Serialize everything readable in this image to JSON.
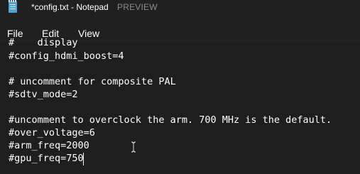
{
  "window": {
    "title": "*config.txt - Notepad",
    "badge": "PREVIEW"
  },
  "menu": {
    "file": "File",
    "edit": "Edit",
    "view": "View"
  },
  "editor": {
    "lines": [
      "#config_hdmi_boost=4",
      "",
      "# uncomment for composite PAL",
      "#sdtv_mode=2",
      "",
      "#uncomment to overclock the arm. 700 MHz is the default.",
      "#over_voltage=6",
      "#arm_freq=2000",
      "#gpu_freq=750"
    ]
  }
}
